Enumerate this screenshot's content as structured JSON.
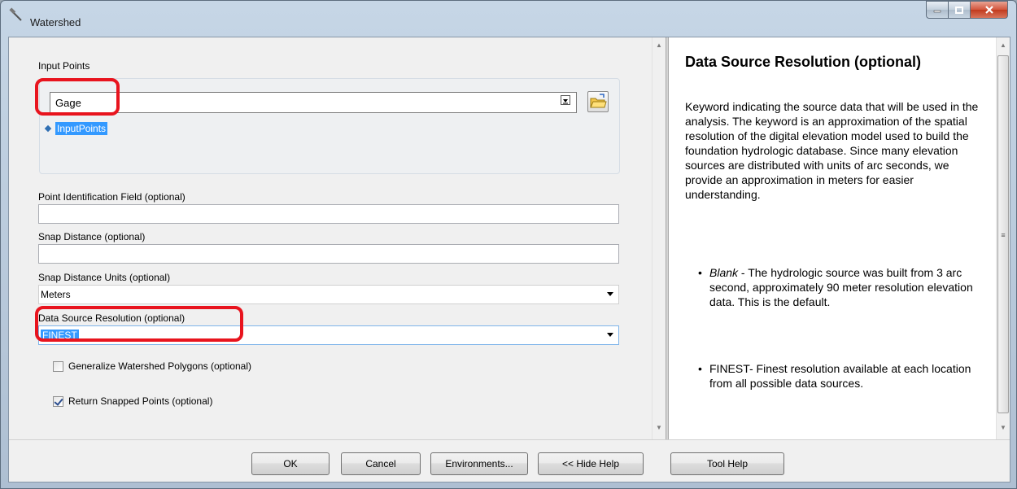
{
  "window": {
    "title": "Watershed",
    "title_icon": "hammer-icon"
  },
  "form": {
    "input_points": {
      "label": "Input Points",
      "value": "Gage",
      "sub_item": "InputPoints"
    },
    "point_id_field": {
      "label": "Point Identification Field (optional)",
      "value": ""
    },
    "snap_distance": {
      "label": "Snap Distance (optional)",
      "value": ""
    },
    "snap_units": {
      "label": "Snap Distance Units (optional)",
      "value": "Meters"
    },
    "data_source_resolution": {
      "label": "Data Source Resolution (optional)",
      "value": "FINEST"
    },
    "generalize": {
      "label": "Generalize Watershed Polygons (optional)",
      "checked": false
    },
    "return_snapped": {
      "label": "Return Snapped Points (optional)",
      "checked": true
    }
  },
  "help": {
    "title": "Data Source Resolution (optional)",
    "paragraph": "Keyword indicating the source data that will be used in the analysis. The keyword is an approximation of the spatial resolution of the digital elevation model used to build the foundation hydrologic database. Since many elevation sources are distributed with units of arc seconds, we provide an approximation in meters for easier understanding.",
    "items": [
      {
        "keyword": "Blank",
        "text": " - The hydrologic source was built from 3 arc second, approximately 90 meter resolution elevation data. This is the default."
      },
      {
        "keyword": "",
        "text": "FINEST- Finest resolution available at each location from all possible data sources."
      }
    ]
  },
  "buttons": {
    "ok": "OK",
    "cancel": "Cancel",
    "environments": "Environments...",
    "hide_help": "<< Hide Help",
    "tool_help": "Tool Help"
  },
  "colors": {
    "highlight": "#3399ff",
    "annotation": "#e8141e"
  }
}
